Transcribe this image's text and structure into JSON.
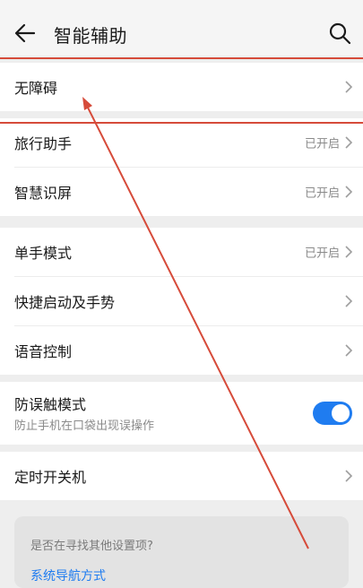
{
  "header": {
    "title": "智能辅助",
    "back_icon": "back-arrow-icon",
    "search_icon": "search-icon"
  },
  "sections": [
    {
      "items": [
        {
          "label": "无障碍",
          "status": ""
        }
      ]
    },
    {
      "items": [
        {
          "label": "旅行助手",
          "status": "已开启"
        },
        {
          "label": "智慧识屏",
          "status": "已开启"
        }
      ]
    },
    {
      "items": [
        {
          "label": "单手模式",
          "status": "已开启"
        },
        {
          "label": "快捷启动及手势",
          "status": ""
        },
        {
          "label": "语音控制",
          "status": ""
        }
      ]
    },
    {
      "items": [
        {
          "label": "防误触模式",
          "sublabel": "防止手机在口袋出现误操作",
          "toggle_on": true
        }
      ]
    },
    {
      "items": [
        {
          "label": "定时开关机",
          "status": ""
        }
      ]
    }
  ],
  "suggestion": {
    "question": "是否在寻找其他设置项?",
    "link": "系统导航方式"
  },
  "colors": {
    "accent": "#1f7cf0",
    "annotation": "#d64b3a"
  }
}
